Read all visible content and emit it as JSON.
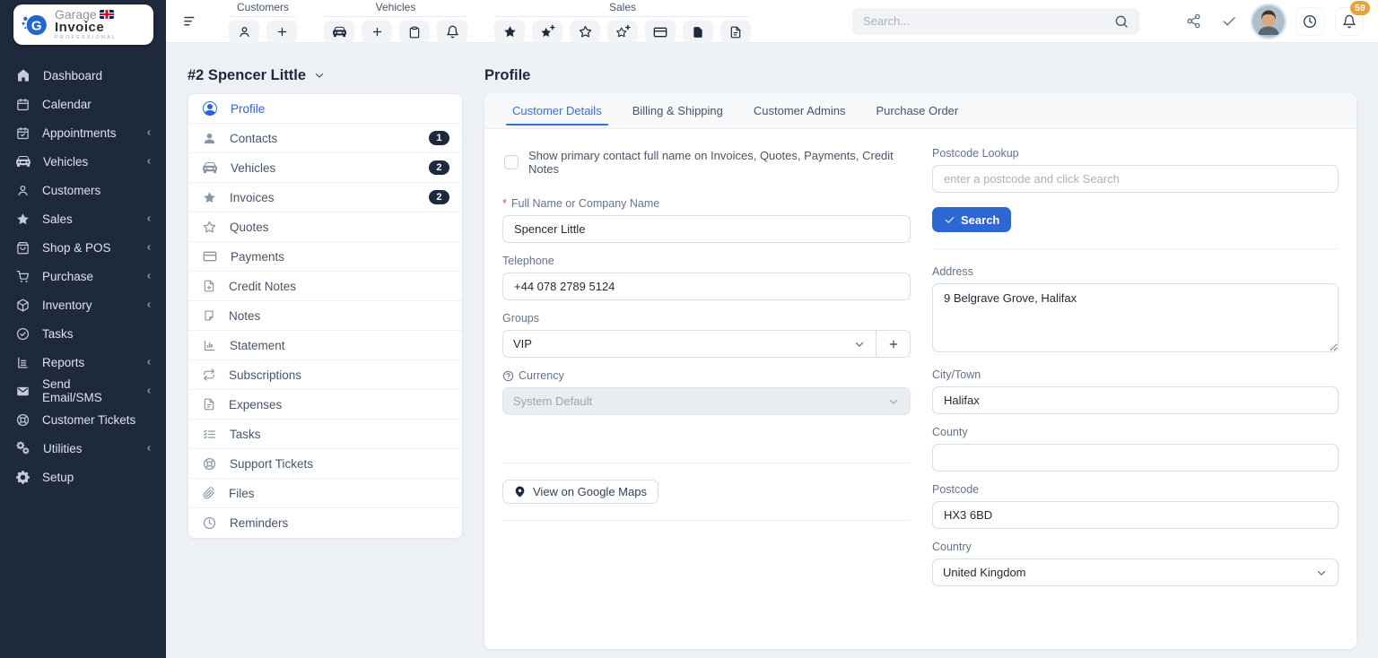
{
  "logo": {
    "line1": "Garage",
    "line2": "Invoice",
    "line3": "PROFESSIONAL"
  },
  "topbar": {
    "groups": [
      {
        "label": "Customers"
      },
      {
        "label": "Vehicles"
      },
      {
        "label": "Sales"
      }
    ],
    "search": {
      "placeholder": "Search..."
    },
    "notification_count": "59"
  },
  "nav": {
    "items": [
      {
        "label": "Dashboard"
      },
      {
        "label": "Calendar"
      },
      {
        "label": "Appointments"
      },
      {
        "label": "Vehicles"
      },
      {
        "label": "Customers"
      },
      {
        "label": "Sales"
      },
      {
        "label": "Shop & POS"
      },
      {
        "label": "Purchase"
      },
      {
        "label": "Inventory"
      },
      {
        "label": "Tasks"
      },
      {
        "label": "Reports"
      },
      {
        "label": "Send Email/SMS"
      },
      {
        "label": "Customer Tickets"
      },
      {
        "label": "Utilities"
      },
      {
        "label": "Setup"
      }
    ]
  },
  "customer": {
    "header": "#2 Spencer Little",
    "menu": [
      {
        "label": "Profile"
      },
      {
        "label": "Contacts",
        "badge": "1"
      },
      {
        "label": "Vehicles",
        "badge": "2"
      },
      {
        "label": "Invoices",
        "badge": "2"
      },
      {
        "label": "Quotes"
      },
      {
        "label": "Payments"
      },
      {
        "label": "Credit Notes"
      },
      {
        "label": "Notes"
      },
      {
        "label": "Statement"
      },
      {
        "label": "Subscriptions"
      },
      {
        "label": "Expenses"
      },
      {
        "label": "Tasks"
      },
      {
        "label": "Support Tickets"
      },
      {
        "label": "Files"
      },
      {
        "label": "Reminders"
      }
    ]
  },
  "profile": {
    "title": "Profile",
    "tabs": [
      {
        "label": "Customer Details"
      },
      {
        "label": "Billing & Shipping"
      },
      {
        "label": "Customer Admins"
      },
      {
        "label": "Purchase Order"
      }
    ],
    "active_tab": "Customer Details",
    "checkbox_label": "Show primary contact full name on Invoices, Quotes, Payments, Credit Notes",
    "fields": {
      "full_name": {
        "label": "Full Name or Company Name",
        "value": "Spencer Little"
      },
      "telephone": {
        "label": "Telephone",
        "value": "+44 078 2789 5124"
      },
      "groups": {
        "label": "Groups",
        "value": "VIP"
      },
      "currency": {
        "label": "Currency",
        "value": "System Default"
      },
      "maps_button": "View on Google Maps",
      "postcode_lookup": {
        "label": "Postcode Lookup",
        "placeholder": "enter a postcode and click Search"
      },
      "search_button": "Search",
      "address": {
        "label": "Address",
        "value": "9 Belgrave Grove, Halifax"
      },
      "city": {
        "label": "City/Town",
        "value": "Halifax"
      },
      "county": {
        "label": "County",
        "value": ""
      },
      "postcode": {
        "label": "Postcode",
        "value": "HX3 6BD"
      },
      "country": {
        "label": "Country",
        "value": "United Kingdom"
      }
    }
  },
  "colors": {
    "accent_blue": "#2e67d3",
    "sidebar_bg": "#1e293b",
    "badge_navy": "#1e293b",
    "notification_amber": "#e8a33d",
    "content_bg": "#edf0f5"
  }
}
